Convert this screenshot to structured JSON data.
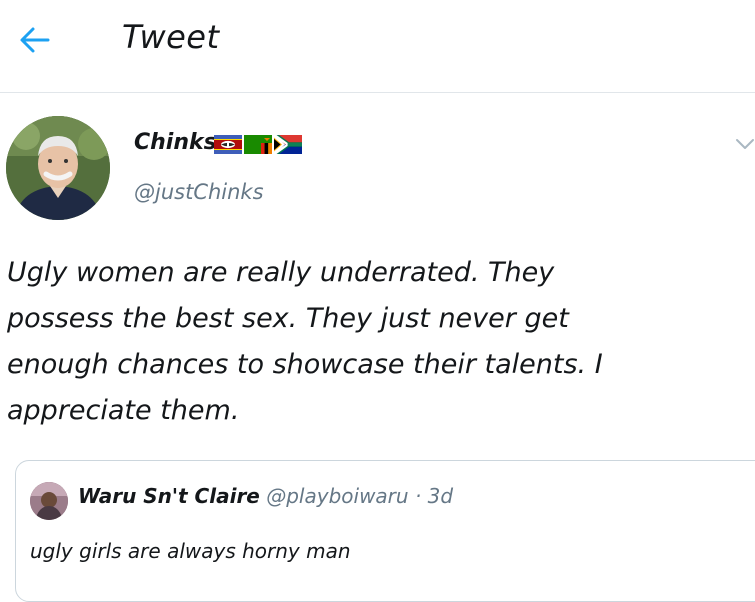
{
  "header": {
    "back_icon": "arrow-left-icon",
    "title": "Tweet",
    "accent_color": "#1da1f2"
  },
  "tweet": {
    "author_name": "Chinks",
    "author_handle": "@justChinks",
    "flags": [
      "swaziland-flag-icon",
      "zambia-flag-icon",
      "south-africa-flag-icon"
    ],
    "text": "Ugly women are really underrated. They\npossess the best sex. They just never get\nenough chances to showcase their talents. I\nappreciate them.",
    "menu_icon": "chevron-down-icon"
  },
  "quoted_tweet": {
    "author_name": "Waru Sn't Claire",
    "author_handle": "@playboiwaru",
    "separator": "·",
    "time": "3d",
    "text": "ugly girls are always horny man"
  }
}
